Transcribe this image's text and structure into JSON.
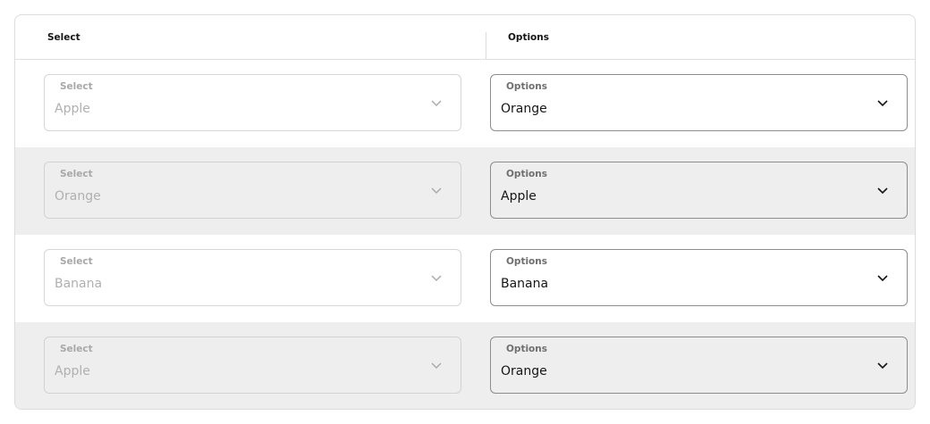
{
  "table": {
    "headers": [
      "Select",
      "Options"
    ],
    "rows": [
      {
        "select": {
          "label": "Select",
          "value": "Apple"
        },
        "options": {
          "label": "Options",
          "value": "Orange"
        }
      },
      {
        "select": {
          "label": "Select",
          "value": "Orange"
        },
        "options": {
          "label": "Options",
          "value": "Apple"
        }
      },
      {
        "select": {
          "label": "Select",
          "value": "Banana"
        },
        "options": {
          "label": "Options",
          "value": "Banana"
        }
      },
      {
        "select": {
          "label": "Select",
          "value": "Apple"
        },
        "options": {
          "label": "Options",
          "value": "Orange"
        }
      }
    ]
  },
  "colors": {
    "zebra_row": "#eeeeee",
    "border": "#dcdcdc",
    "text_primary": "#161616",
    "text_disabled": "#b0b0b0"
  },
  "icons": {
    "dropdown": "chevron-down-icon"
  }
}
